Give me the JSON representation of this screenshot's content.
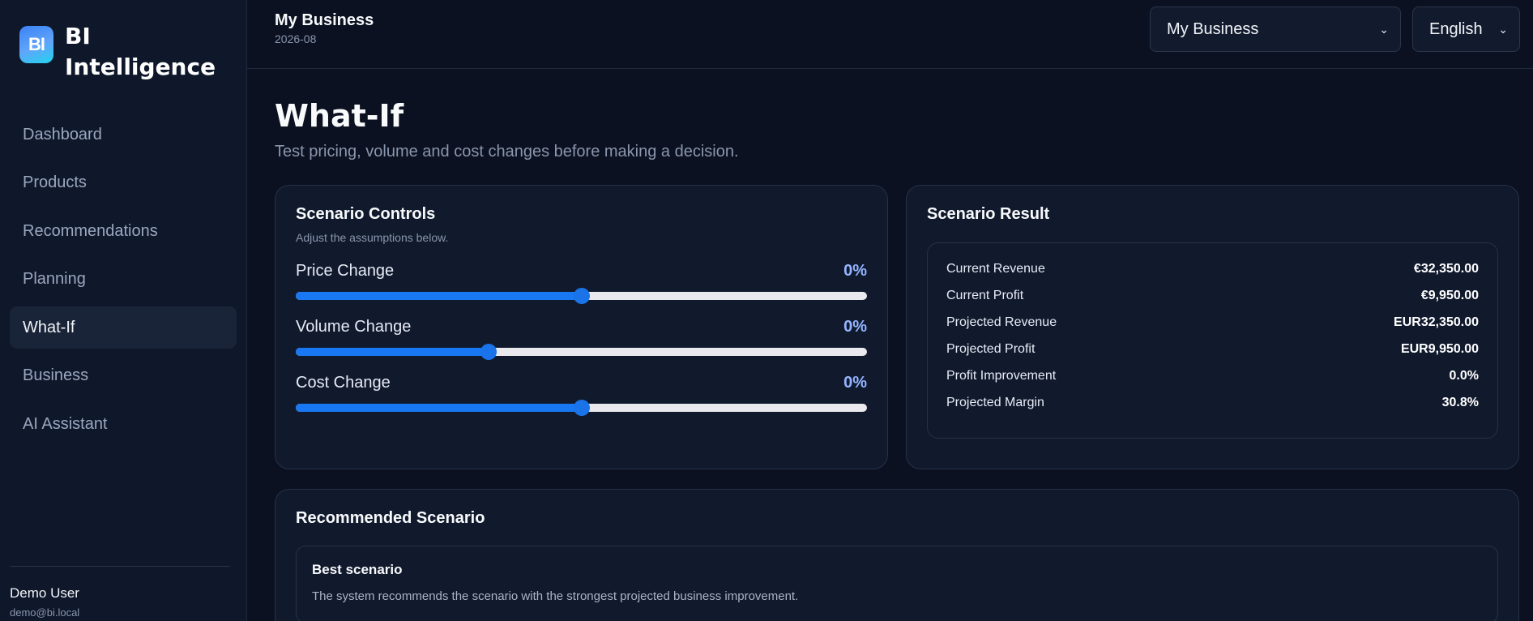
{
  "brand": {
    "logo": "BI",
    "name": "BI Intelligence"
  },
  "nav": [
    {
      "label": "Dashboard"
    },
    {
      "label": "Products"
    },
    {
      "label": "Recommendations"
    },
    {
      "label": "Planning"
    },
    {
      "label": "What-If",
      "active": true
    },
    {
      "label": "Business"
    },
    {
      "label": "AI Assistant"
    }
  ],
  "user": {
    "name": "Demo User",
    "email": "demo@bi.local"
  },
  "header": {
    "title": "My Business",
    "period": "2026-08",
    "business_select": "My Business",
    "language_select": "English"
  },
  "page": {
    "title": "What-If",
    "subtitle": "Test pricing, volume and cost changes before making a decision."
  },
  "controls": {
    "title": "Scenario Controls",
    "subtitle": "Adjust the assumptions below.",
    "sliders": [
      {
        "label": "Price Change",
        "value": "0%",
        "position": 0.5
      },
      {
        "label": "Volume Change",
        "value": "0%",
        "position": 0.337
      },
      {
        "label": "Cost Change",
        "value": "0%",
        "position": 0.5
      }
    ]
  },
  "result": {
    "title": "Scenario Result",
    "rows": [
      {
        "label": "Current Revenue",
        "value": "€32,350.00"
      },
      {
        "label": "Current Profit",
        "value": "€9,950.00"
      },
      {
        "label": "Projected Revenue",
        "value": "EUR32,350.00"
      },
      {
        "label": "Projected Profit",
        "value": "EUR9,950.00"
      },
      {
        "label": "Profit Improvement",
        "value": "0.0%"
      },
      {
        "label": "Projected Margin",
        "value": "30.8%"
      }
    ]
  },
  "recommended": {
    "title": "Recommended Scenario",
    "best_title": "Best scenario",
    "best_text": "The system recommends the scenario with the strongest projected business improvement."
  },
  "colors": {
    "accent": "#1877f2",
    "value_highlight": "#93b4ff",
    "background": "#0b1120"
  }
}
